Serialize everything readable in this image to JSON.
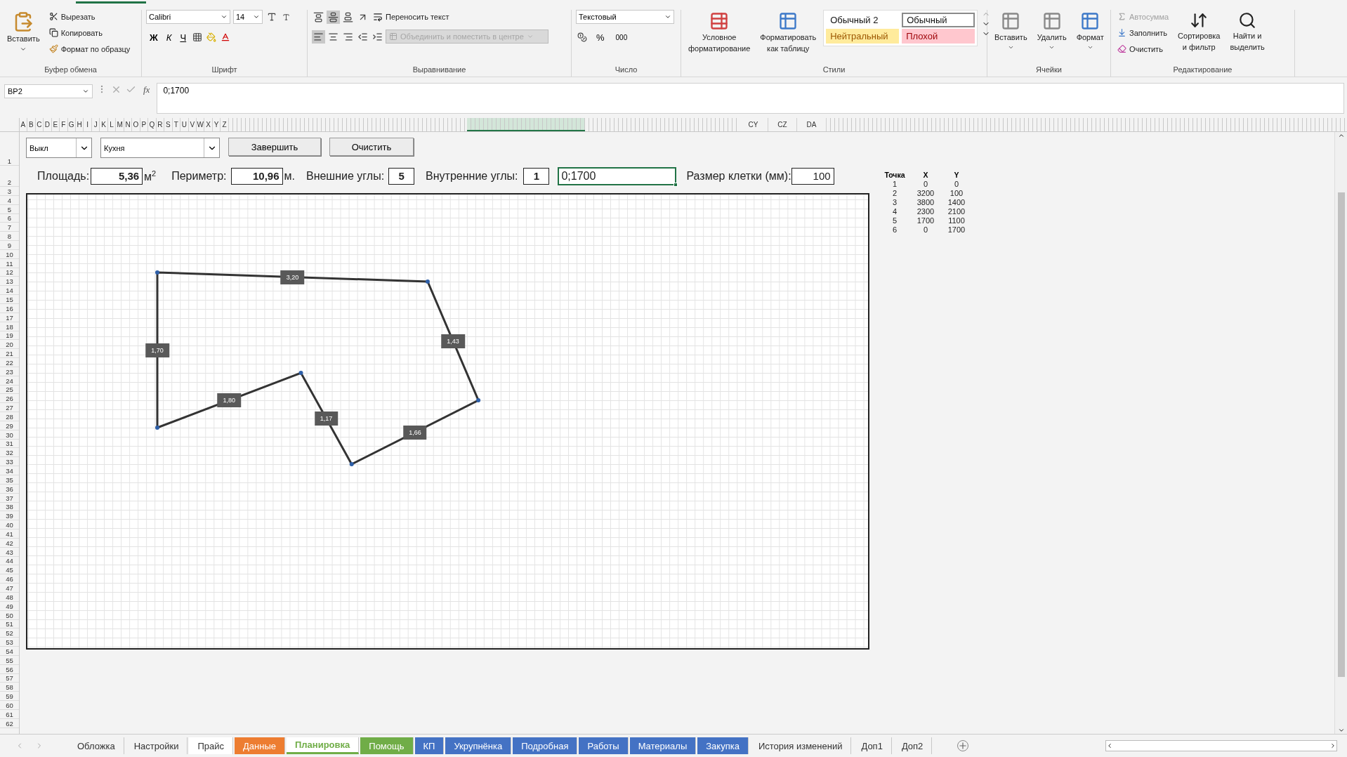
{
  "ribbon": {
    "clipboard": {
      "paste": "Вставить",
      "cut": "Вырезать",
      "copy": "Копировать",
      "format_painter": "Формат по образцу",
      "label": "Буфер обмена"
    },
    "font": {
      "name": "Calibri",
      "size": "14",
      "bold": "Ж",
      "italic": "К",
      "underline": "Ч",
      "label": "Шрифт"
    },
    "alignment": {
      "wrap": "Переносить текст",
      "merge": "Объединить и поместить в центре",
      "merge_disabled": true,
      "label": "Выравнивание"
    },
    "number": {
      "format": "Текстовый",
      "percent": "%",
      "thousands": "000",
      "label": "Число"
    },
    "styles": {
      "conditional": [
        "Условное",
        "форматирование"
      ],
      "as_table": [
        "Форматировать",
        "как таблицу"
      ],
      "label": "Стили",
      "cells": [
        {
          "text": "Обычный 2",
          "color": "#ffffff",
          "selected": false
        },
        {
          "text": "Обычный",
          "color": "#ffffff",
          "selected": true
        },
        {
          "text": "Нейтральный",
          "color": "#ffeb9c",
          "selected": false
        },
        {
          "text": "Плохой",
          "color": "#ffc7ce",
          "selected": false
        }
      ]
    },
    "cells": {
      "insert": "Вставить",
      "delete": "Удалить",
      "format": "Формат",
      "label": "Ячейки"
    },
    "editing": {
      "autosum": "Автосумма",
      "autosum_disabled": true,
      "fill": "Заполнить",
      "clear": "Очистить",
      "sort": [
        "Сортировка",
        "и фильтр"
      ],
      "find": [
        "Найти и",
        "выделить"
      ],
      "label": "Редактирование"
    }
  },
  "formula_bar": {
    "name_box": "BP2",
    "fx": "fx",
    "formula": "0;1700"
  },
  "columns": [
    "A",
    "B",
    "C",
    "D",
    "E",
    "F",
    "G",
    "H",
    "I",
    "J",
    "K",
    "L",
    "M",
    "N",
    "O",
    "P",
    "Q",
    "R",
    "S",
    "T",
    "U",
    "V",
    "W",
    "X",
    "Y",
    "Z"
  ],
  "columns_far": [
    "CY",
    "CZ",
    "DA"
  ],
  "rows": [
    "1",
    "2",
    "3",
    "4",
    "5",
    "6",
    "7",
    "8",
    "9",
    "10",
    "11",
    "12",
    "13",
    "14",
    "15",
    "16",
    "17",
    "18",
    "19",
    "20",
    "21",
    "22",
    "23",
    "24",
    "25",
    "26",
    "27",
    "28",
    "29",
    "30",
    "31",
    "32",
    "33",
    "34",
    "35",
    "36",
    "37",
    "38",
    "39",
    "40",
    "41",
    "42",
    "43",
    "44",
    "45",
    "46",
    "47",
    "48",
    "49",
    "50",
    "51",
    "52",
    "53",
    "54",
    "55",
    "56",
    "57",
    "58",
    "59",
    "60",
    "61",
    "62"
  ],
  "controls": {
    "mode": "Выкл",
    "room": "Кухня",
    "finish": "Завершить",
    "clear": "Очистить"
  },
  "metrics": {
    "area_label": "Площадь:",
    "area": "5,36",
    "area_unit": "м",
    "area_power": "2",
    "perimeter_label": "Периметр:",
    "perimeter": "10,96",
    "perimeter_unit": "м.",
    "outer_label": "Внешние углы:",
    "outer": "5",
    "inner_label": "Внутренние углы:",
    "inner": "1",
    "active_cell": "0;1700",
    "cell_size_label": "Размер клетки (мм):",
    "cell_size": "100"
  },
  "edges": [
    "3,20",
    "1,43",
    "1,66",
    "1,17",
    "1,80",
    "1,70"
  ],
  "points_table": {
    "columns": [
      "Точка",
      "X",
      "Y"
    ],
    "rows": [
      [
        "1",
        "0",
        "0"
      ],
      [
        "2",
        "3200",
        "100"
      ],
      [
        "3",
        "3800",
        "1400"
      ],
      [
        "4",
        "2300",
        "2100"
      ],
      [
        "5",
        "1700",
        "1100"
      ],
      [
        "6",
        "0",
        "1700"
      ]
    ]
  },
  "sheet_tabs": [
    {
      "label": "Обложка",
      "selected": false
    },
    {
      "label": "Настройки",
      "selected": false
    },
    {
      "label": "Прайс",
      "selected": false,
      "color": "#ffffff"
    },
    {
      "label": "Данные",
      "selected": false,
      "color": "#ed7d31"
    },
    {
      "label": "Планировка",
      "selected": true,
      "color": "#70ad47"
    },
    {
      "label": "Помощь",
      "selected": false,
      "color": "#70ad47"
    },
    {
      "label": "КП",
      "selected": false,
      "color": "#4472c4"
    },
    {
      "label": "Укрупнёнка",
      "selected": false,
      "color": "#4472c4"
    },
    {
      "label": "Подробная",
      "selected": false,
      "color": "#4472c4"
    },
    {
      "label": "Работы",
      "selected": false,
      "color": "#4472c4"
    },
    {
      "label": "Материалы",
      "selected": false,
      "color": "#4472c4"
    },
    {
      "label": "Закупка",
      "selected": false,
      "color": "#4472c4"
    },
    {
      "label": "История изменений",
      "selected": false
    },
    {
      "label": "Доп1",
      "selected": false
    },
    {
      "label": "Доп2",
      "selected": false
    }
  ]
}
